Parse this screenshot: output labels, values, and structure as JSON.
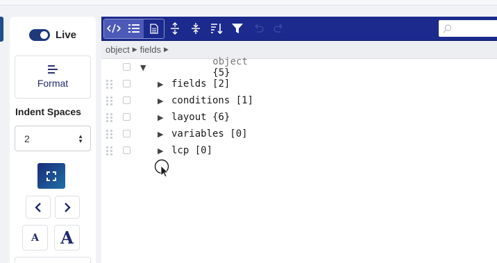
{
  "sidebar": {
    "live_label": "Live",
    "format_label": "Format",
    "indent_title": "Indent Spaces",
    "indent_value": "2",
    "font_small": "A",
    "font_large": "A"
  },
  "toolbar": {
    "modes": [
      "code-icon",
      "tree-icon",
      "text-icon"
    ],
    "active_mode": "tree-icon",
    "tools": [
      "expand-all-icon",
      "collapse-all-icon",
      "sort-icon",
      "filter-icon",
      "undo-icon",
      "redo-icon"
    ],
    "search_placeholder": ""
  },
  "breadcrumb": {
    "items": [
      "object",
      "fields"
    ]
  },
  "tree": {
    "root": {
      "key": "object",
      "count": "{5}"
    },
    "children": [
      {
        "key": "fields",
        "count": "[2]"
      },
      {
        "key": "conditions",
        "count": "[1]"
      },
      {
        "key": "layout",
        "count": "{6}"
      },
      {
        "key": "variables",
        "count": "[0]"
      },
      {
        "key": "lcp",
        "count": "[0]"
      }
    ]
  },
  "colors": {
    "toolbar": "#1b2a8c",
    "accent": "#1e3a7b"
  }
}
